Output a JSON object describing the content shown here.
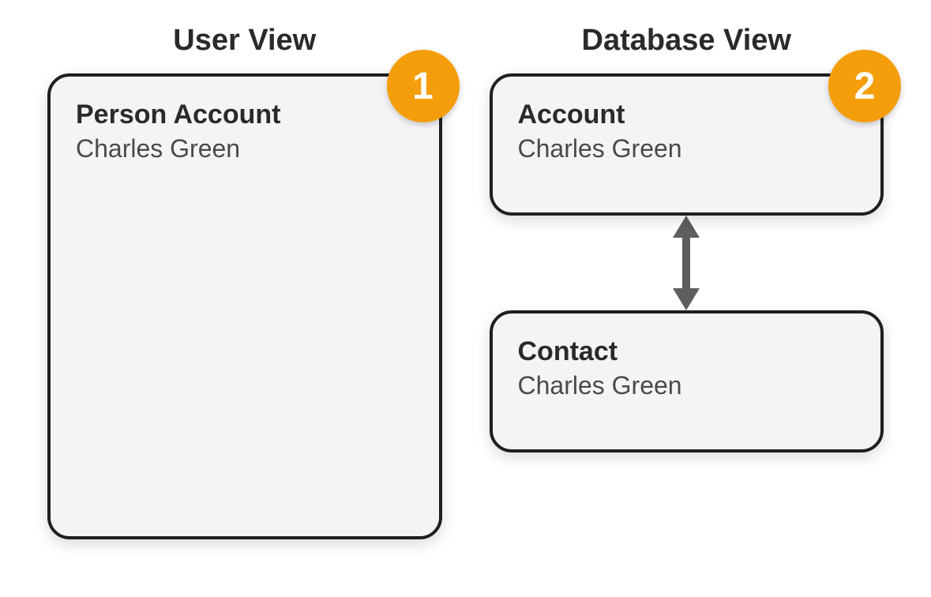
{
  "views": {
    "user": {
      "title": "User View",
      "badge": "1",
      "card": {
        "title": "Person Account",
        "subtitle": "Charles Green"
      }
    },
    "database": {
      "title": "Database View",
      "badge": "2",
      "account_card": {
        "title": "Account",
        "subtitle": "Charles Green"
      },
      "contact_card": {
        "title": "Contact",
        "subtitle": "Charles Green"
      }
    }
  },
  "colors": {
    "badge": "#f59e0b",
    "card_border": "#1f1f1f",
    "card_bg": "#f4f4f6",
    "text_dark": "#2a2a2a",
    "text_medium": "#4a4a4a",
    "arrow": "#5e5e5e"
  }
}
